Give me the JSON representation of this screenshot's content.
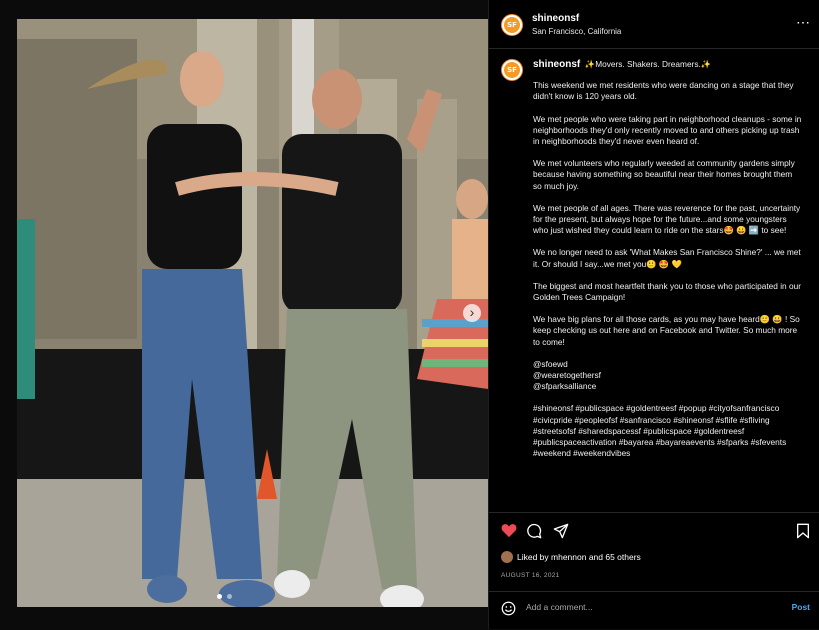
{
  "post": {
    "username": "shineonsf",
    "location": "San Francisco, California",
    "avatar_text": "SF",
    "more_icon": "⋯",
    "caption_header": "✨Movers. Shakers. Dreamers.✨",
    "caption_paragraphs": [
      "This weekend we met residents who were dancing on a stage that they didn't know is 120 years old.",
      "We met people who were taking part in neighborhood cleanups - some in neighborhoods they'd only recently moved to and others picking up trash in neighborhoods they'd never even heard of.",
      "We met volunteers who regularly weeded at community gardens simply because having something so beautiful near their homes brought them so much joy.",
      "We met people of all ages. There was reverence for the past, uncertainty for the present, but always hope for the future...and some youngsters who just wished they could learn to ride on the stars🤩 😀 ➡️ to see!",
      "We no longer need to ask 'What Makes San Francisco Shine?' ... we met it. Or should I say...we met you🙂 🤩 💛",
      "The biggest and most heartfelt thank you to those who participated in our Golden Trees Campaign!",
      "We have big plans for all those cards, as you may have heard🙂 😀 ! So keep checking us out here and on Facebook and Twitter. So much more to come!",
      "@sfoewd\n@wearetogethersf\n@sfparksalliance",
      "#shineonsf #publicspace #goldentreesf #popup #cityofsanfrancisco #civicpride #peopleofsf #sanfrancisco #shineonsf #sflife #sfliving #streetsofsf #sharedspacessf #publicspace #goldentreesf #publicspaceactivation #bayarea #bayareaevents #sfparks #sfevents #weekend #weekendvibes"
    ],
    "likes_text": "Liked by mhennon and 65 others",
    "date": "AUGUST 16, 2021",
    "comment_placeholder": "Add a comment...",
    "post_label": "Post",
    "carousel_next": "›"
  },
  "colors": {
    "like_red": "#ed4956",
    "post_blue": "#4aa6f0",
    "avatar_orange": "#f39b26"
  }
}
